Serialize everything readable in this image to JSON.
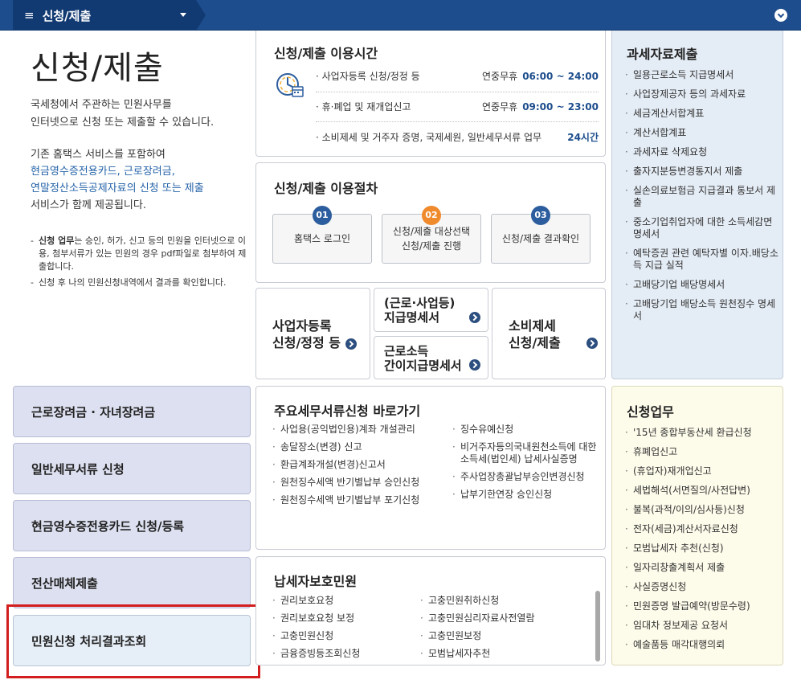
{
  "topbar": {
    "menu_icon": "≡",
    "title": "신청/제출"
  },
  "intro": {
    "title": "신청/제출",
    "para1": [
      "국세청에서 주관하는 민원사무를",
      "인터넷으로 신청 또는 제출할 수 있습니다."
    ],
    "para2_line1": "기존 홈택스 서비스를 포함하여",
    "para2_hl1": "현금영수증전용카드, 근로장려금,",
    "para2_hl2": "연말정산소득공제자료의 신청 또는 제출",
    "para2_line4": "서비스가 함께 제공됩니다.",
    "note1_bold": "신청 업무",
    "note1_rest": "는 승인, 허가, 신고 등의 민원을 인터넷으로 이용, 첨부서류가 있는 민원의 경우 pdf파일로 첨부하여 제출합니다.",
    "note2": "신청 후 나의 민원신청내역에서 결과를 확인합니다."
  },
  "time": {
    "title": "신청/제출 이용시간",
    "rows": [
      {
        "label": "· 사업자등록 신청/정정 등",
        "days": "연중무휴",
        "hours": "06:00 ~ 24:00"
      },
      {
        "label": "· 휴·폐업 및 재개업신고",
        "days": "연중무휴",
        "hours": "09:00 ~ 23:00"
      },
      {
        "label": "· 소비제세 및 거주자 증명, 국제세원, 일반세무서류 업무",
        "days": "",
        "hours": "24시간"
      }
    ]
  },
  "procedure": {
    "title": "신청/제출 이용절차",
    "steps": [
      {
        "num": "01",
        "line1": "홈택스 로그인",
        "line2": ""
      },
      {
        "num": "02",
        "line1": "신청/제출 대상선택",
        "line2": "신청/제출 진행"
      },
      {
        "num": "03",
        "line1": "신청/제출 결과확인",
        "line2": ""
      }
    ]
  },
  "links": {
    "biz_line1": "사업자등록",
    "biz_line2": "신청/정정 등",
    "wage_line1": "(근로·사업등)",
    "wage_line2": "지급명세서",
    "simple_line1": "근로소득",
    "simple_line2": "간이지급명세서",
    "consume_line1": "소비제세",
    "consume_line2": "신청/제출"
  },
  "left_nav": [
    "근로장려금 · 자녀장려금",
    "일반세무서류 신청",
    "현금영수증전용카드 신청/등록",
    "전산매체제출",
    "민원신청 처리결과조회"
  ],
  "shortcuts": {
    "title": "주요세무서류신청 바로가기",
    "left": [
      "사업용(공익법인용)계좌 개설관리",
      "송달장소(변경) 신고",
      "환급계좌개설(변경)신고서",
      "원천징수세액 반기별납부 승인신청",
      "원천징수세액 반기별납부 포기신청"
    ],
    "right": [
      "징수유예신청",
      "비거주자등의국내원천소득에 대한 소득세(법인세) 납세사실증명",
      "주사업장총괄납부승인변경신청",
      "납부기한연장 승인신청"
    ]
  },
  "protection": {
    "title": "납세자보호민원",
    "left": [
      "권리보호요청",
      "권리보호요청 보정",
      "고충민원신청",
      "금융증빙등조회신청"
    ],
    "right": [
      "고충민원취하신청",
      "고충민원심리자료사전열람",
      "고충민원보정",
      "모범납세자추천"
    ]
  },
  "taxdata": {
    "title": "과세자료제출",
    "items": [
      "일용근로소득 지급명세서",
      "사업장제공자 등의 과세자료",
      "세금계산서합계표",
      "계산서합계표",
      "과세자료 삭제요청",
      "출자지분등변경통지서 제출",
      "실손의료보험금 지급결과 통보서 제출",
      "중소기업취업자에 대한 소득세감면명세서",
      "예탁증권 관련 예탁자별 이자.배당소득 지급 실적",
      "고배당기업 배당명세서",
      "고배당기업 배당소득 원천징수 명세서"
    ]
  },
  "apply": {
    "title": "신청업무",
    "items": [
      "'15년 종합부동산세 환급신청",
      "휴폐업신고",
      "(휴업자)재개업신고",
      "세법해석(서면질의/사전답변)",
      "불복(과적/이의/심사등)신청",
      "전자(세금)계산서자료신청",
      "모범납세자 추천(신청)",
      "일자리창출계획서 제출",
      "사실증명신청",
      "민원증명 발급예약(방문수령)",
      "임대차 정보제공 요청서",
      "예술품등 매각대행의뢰"
    ]
  }
}
